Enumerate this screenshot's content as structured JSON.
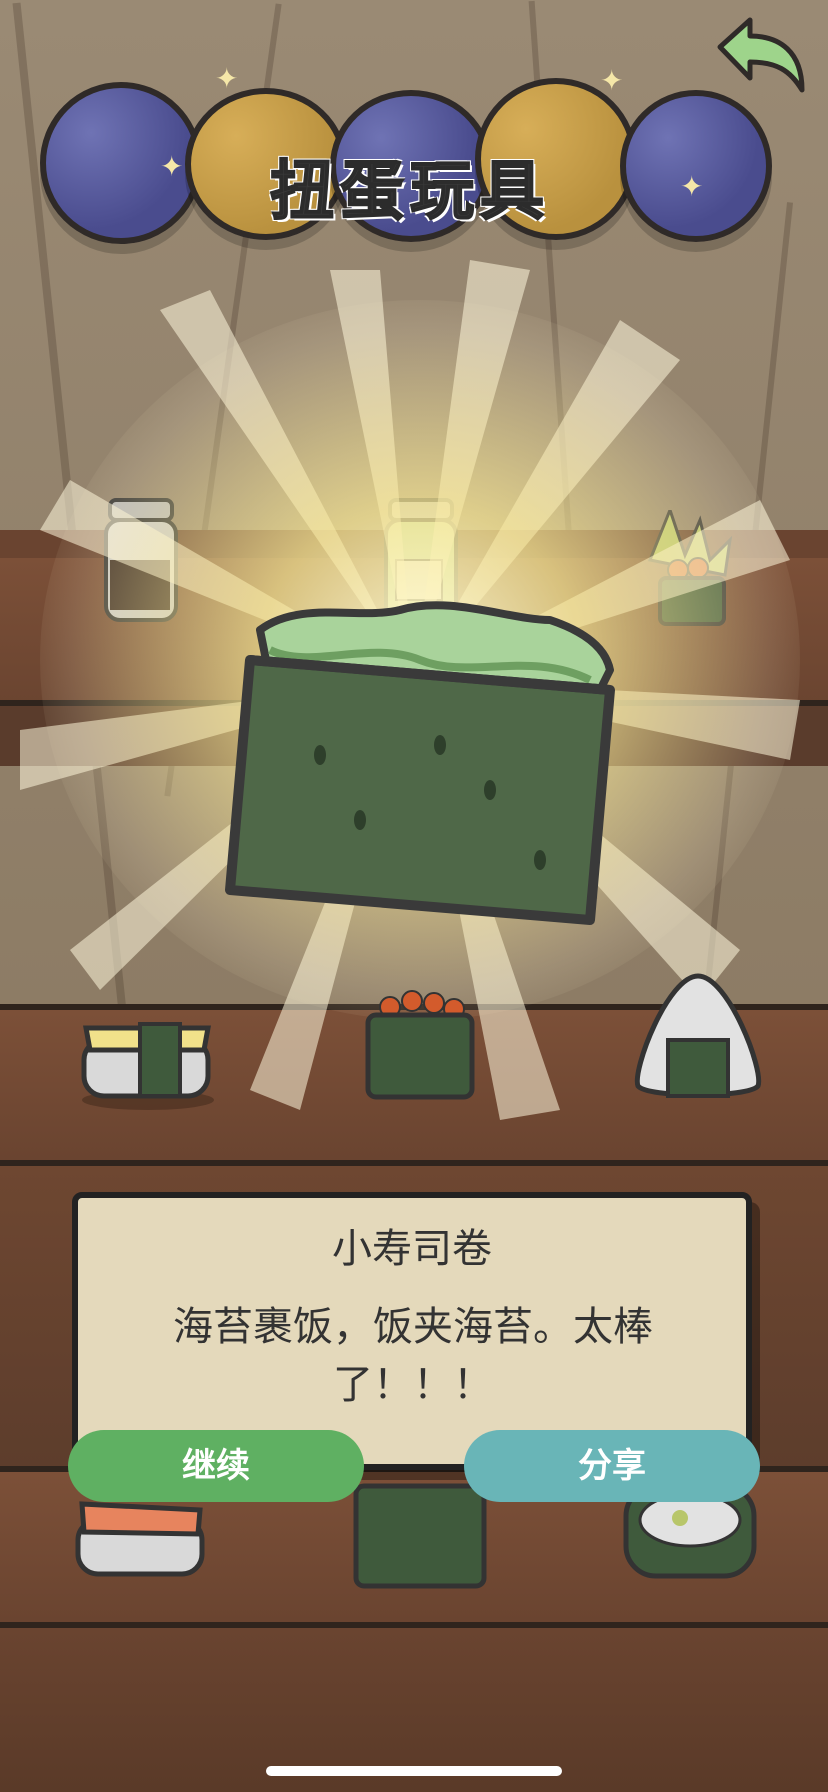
{
  "header": {
    "title": "扭蛋玩具",
    "back_icon": "back-arrow-icon"
  },
  "featured_item": {
    "icon": "gunkan-sushi-roll-icon"
  },
  "shelf_items": {
    "row1": [
      "soy-sauce-jar-icon",
      "wasabi-jar-icon",
      "ikura-corn-gunkan-icon"
    ],
    "row2": [
      "tamago-sushi-icon",
      "ikura-gunkan-icon",
      "onigiri-icon"
    ],
    "row3": [
      "salmon-sushi-icon",
      "seaweed-gunkan-icon",
      "futomaki-icon"
    ]
  },
  "dialog": {
    "title": "小寿司卷",
    "description": "海苔裹饭，饭夹海苔。太棒了！！！"
  },
  "buttons": {
    "continue_label": "继续",
    "share_label": "分享"
  },
  "colors": {
    "continue": "#5fb062",
    "share": "#69b5b7",
    "dialog_bg": "#e4d9bb",
    "ball_blue": "#4a4c8e",
    "ball_yellow": "#b9913e"
  }
}
